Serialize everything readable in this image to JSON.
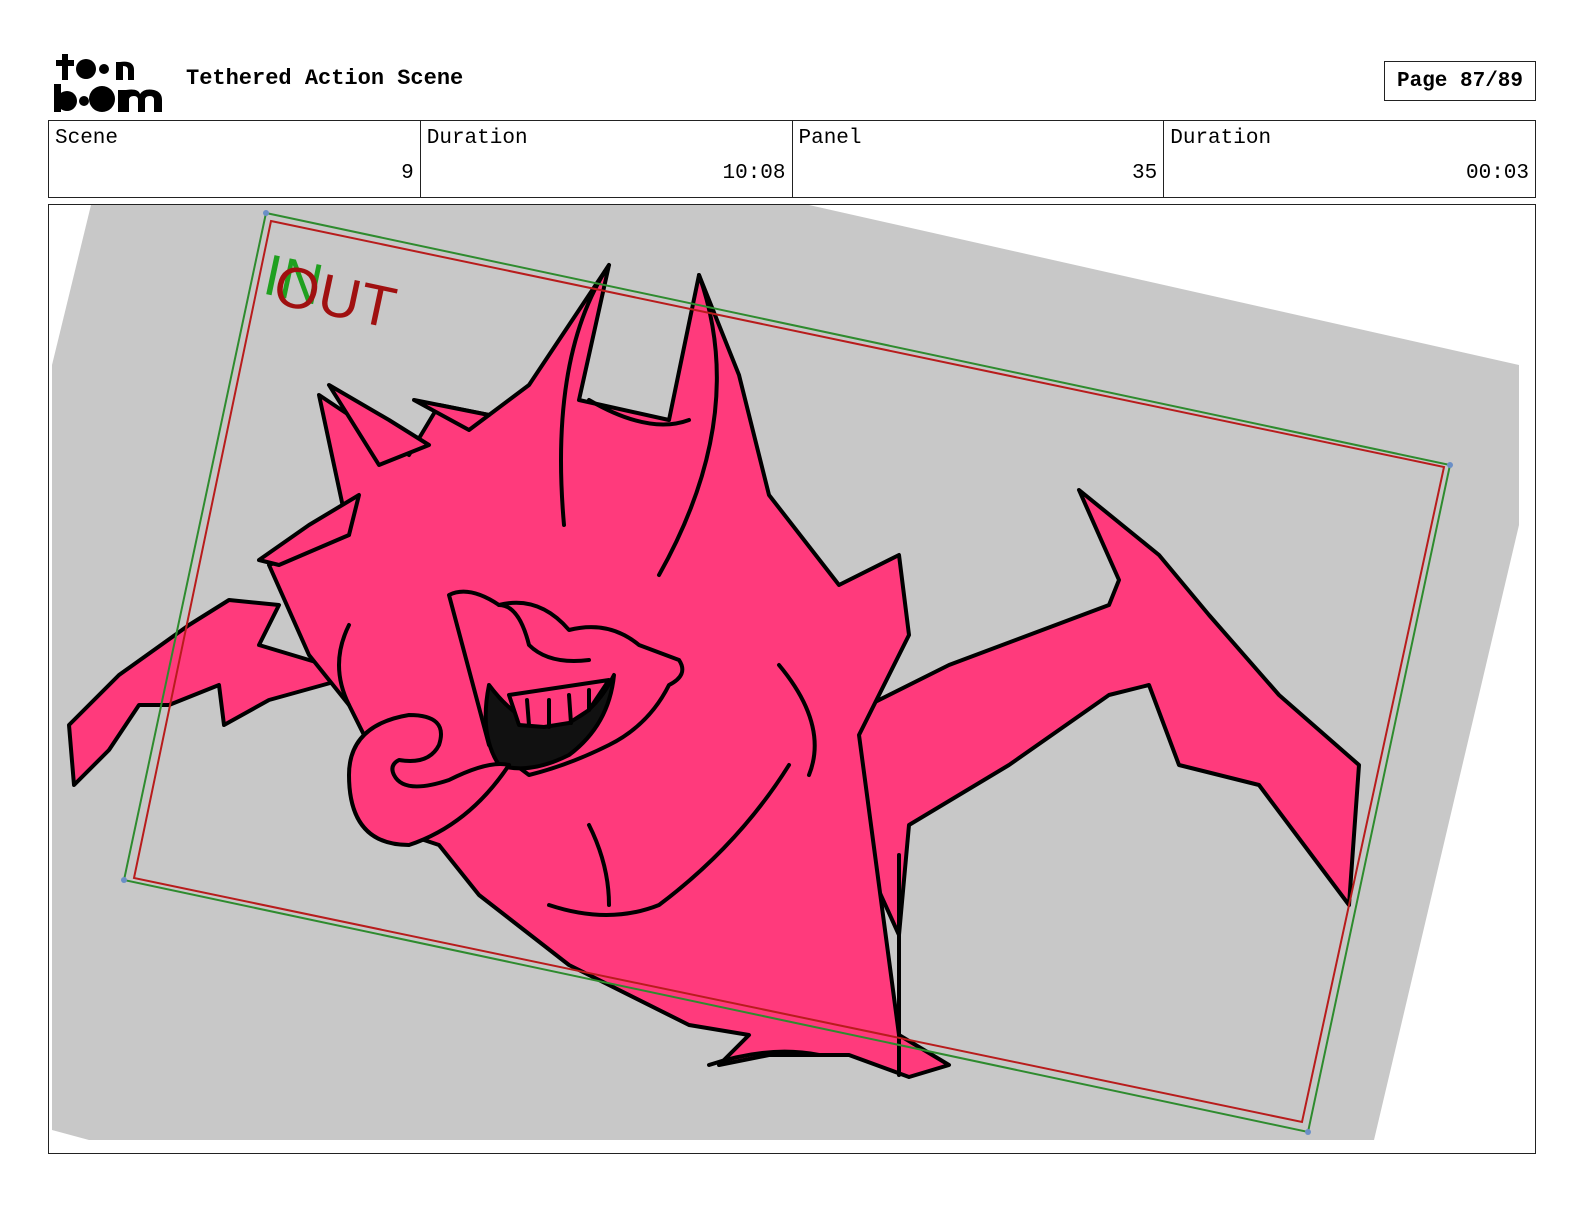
{
  "header": {
    "logo_text_top": "toon",
    "logo_text_bottom": "boom",
    "title": "Tethered Action Scene",
    "page": "Page 87/89"
  },
  "info": {
    "scene_label": "Scene",
    "scene_value": "9",
    "scene_duration_label": "Duration",
    "scene_duration_value": "10:08",
    "panel_label": "Panel",
    "panel_value": "35",
    "panel_duration_label": "Duration",
    "panel_duration_value": "00:03"
  },
  "panel": {
    "in_label": "IN",
    "out_label": "OUT",
    "colors": {
      "character_fill": "#ff3a7c",
      "background_gray": "#c8c8c8",
      "in_frame": "#2e8b2e",
      "out_frame": "#b81c1c"
    }
  }
}
